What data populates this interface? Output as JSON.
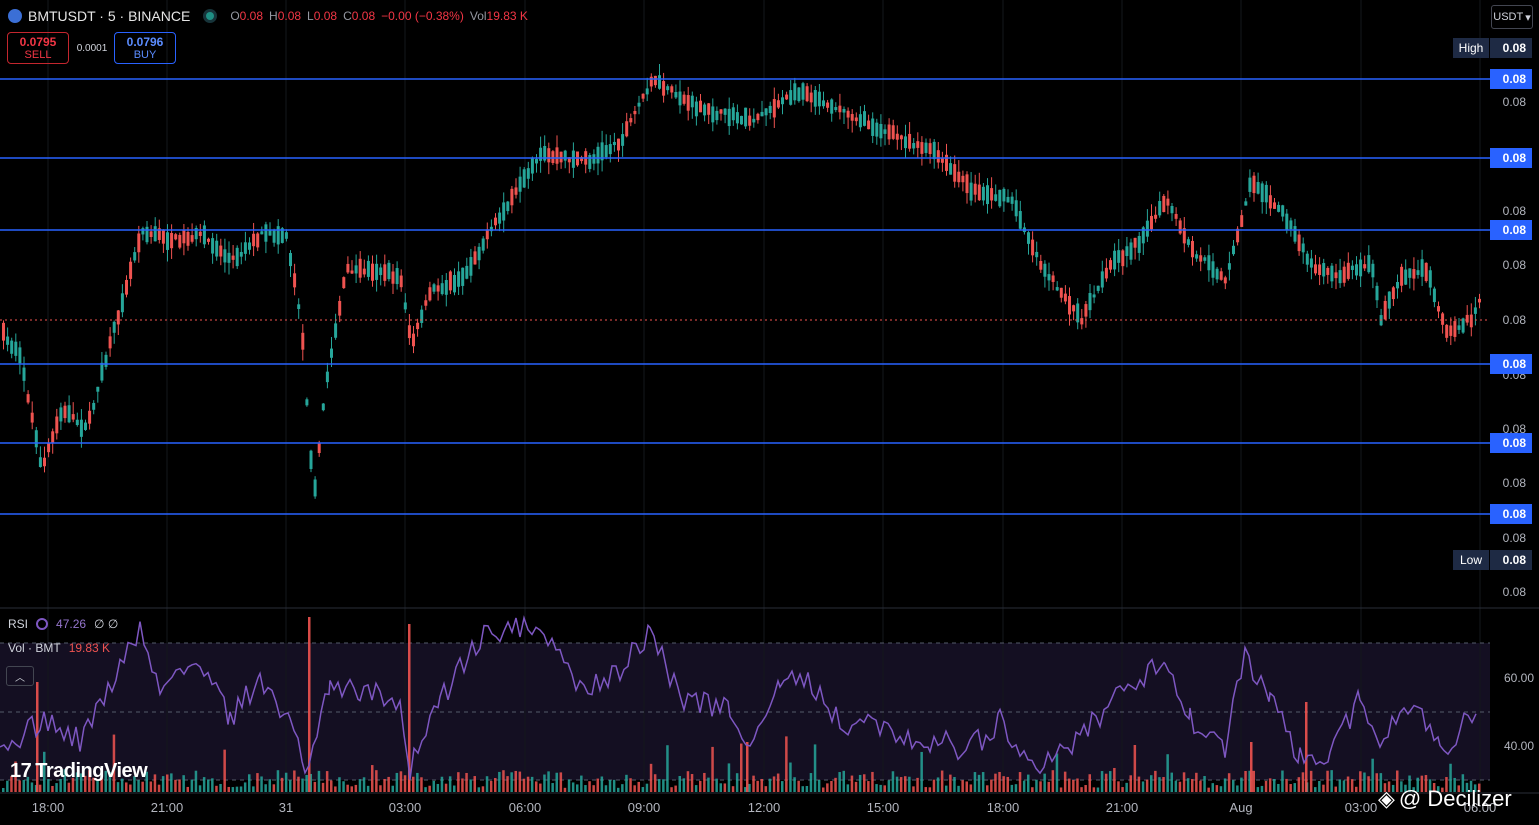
{
  "header": {
    "symbol": "BMTUSDT · 5 · BINANCE",
    "ohlc": [
      {
        "label": "O",
        "value": "0.08"
      },
      {
        "label": "H",
        "value": "0.08"
      },
      {
        "label": "L",
        "value": "0.08"
      },
      {
        "label": "C",
        "value": "0.08"
      }
    ],
    "change": "−0.00 (−0.38%)",
    "vol_label": "Vol",
    "vol_value": "19.83 K"
  },
  "trade": {
    "sell_price": "0.0795",
    "sell_label": "SELL",
    "spread": "0.0001",
    "buy_price": "0.0796",
    "buy_label": "BUY"
  },
  "currency_button": "USDT",
  "indicators": {
    "rsi_name": "RSI",
    "rsi_value": "47.26",
    "rsi_extra": "∅ ∅",
    "vol_name": "Vol · BMT",
    "vol_value": "19.83 K"
  },
  "price_axis": {
    "high_label": "High",
    "low_label": "Low",
    "value": "0.08",
    "tick_count": 14
  },
  "rsi_axis": [
    "60.00",
    "40.00"
  ],
  "time_axis": [
    "18:00",
    "21:00",
    "31",
    "03:00",
    "06:00",
    "09:00",
    "12:00",
    "15:00",
    "18:00",
    "21:00",
    "Aug",
    "03:00",
    "06:00"
  ],
  "branding": {
    "logo_text": "TradingView",
    "watermark": "@ Decilizer"
  },
  "colors": {
    "up": "#26a69a",
    "down": "#ef5350",
    "level_line": "#2962ff",
    "rsi": "#7e57c2",
    "background": "#000000"
  }
}
